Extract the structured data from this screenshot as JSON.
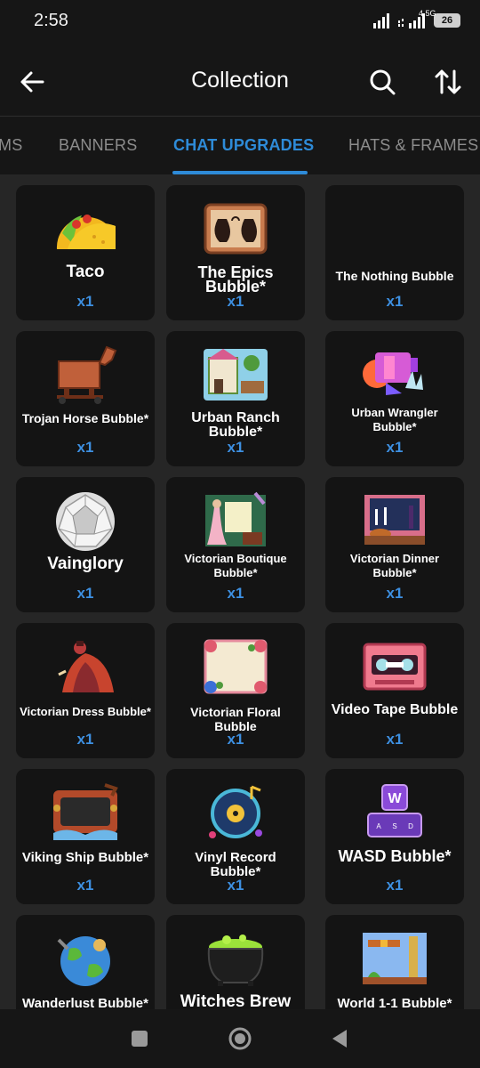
{
  "status": {
    "time": "2:58",
    "network": "4.5G",
    "battery": "26"
  },
  "header": {
    "title": "Collection"
  },
  "tabs": [
    {
      "label": "MS"
    },
    {
      "label": "BANNERS"
    },
    {
      "label": "CHAT UPGRADES"
    },
    {
      "label": "HATS & FRAMES"
    }
  ],
  "items": [
    {
      "name": "Taco",
      "qty": "x1"
    },
    {
      "name": "The Epics Bubble*",
      "qty": "x1"
    },
    {
      "name": "The Nothing Bubble",
      "qty": "x1"
    },
    {
      "name": "Trojan Horse Bubble*",
      "qty": "x1"
    },
    {
      "name": "Urban Ranch Bubble*",
      "qty": "x1"
    },
    {
      "name": "Urban Wrangler Bubble*",
      "qty": "x1"
    },
    {
      "name": "Vainglory",
      "qty": "x1"
    },
    {
      "name": "Victorian Boutique Bubble*",
      "qty": "x1"
    },
    {
      "name": "Victorian Dinner Bubble*",
      "qty": "x1"
    },
    {
      "name": "Victorian Dress Bubble*",
      "qty": "x1"
    },
    {
      "name": "Victorian Floral Bubble",
      "qty": "x1"
    },
    {
      "name": "Video Tape Bubble",
      "qty": "x1"
    },
    {
      "name": "Viking Ship Bubble*",
      "qty": "x1"
    },
    {
      "name": "Vinyl Record Bubble*",
      "qty": "x1"
    },
    {
      "name": "WASD Bubble*",
      "qty": "x1"
    },
    {
      "name": "Wanderlust Bubble*",
      "qty": ""
    },
    {
      "name": "Witches Brew",
      "qty": ""
    },
    {
      "name": "World 1-1 Bubble*",
      "qty": ""
    }
  ],
  "item_art_letter": "W",
  "keys_letters": [
    "A",
    "S",
    "D"
  ],
  "colors": {
    "accent": "#2e8bd8",
    "qty": "#3d8fe0",
    "card": "#141414",
    "background": "#262626"
  }
}
